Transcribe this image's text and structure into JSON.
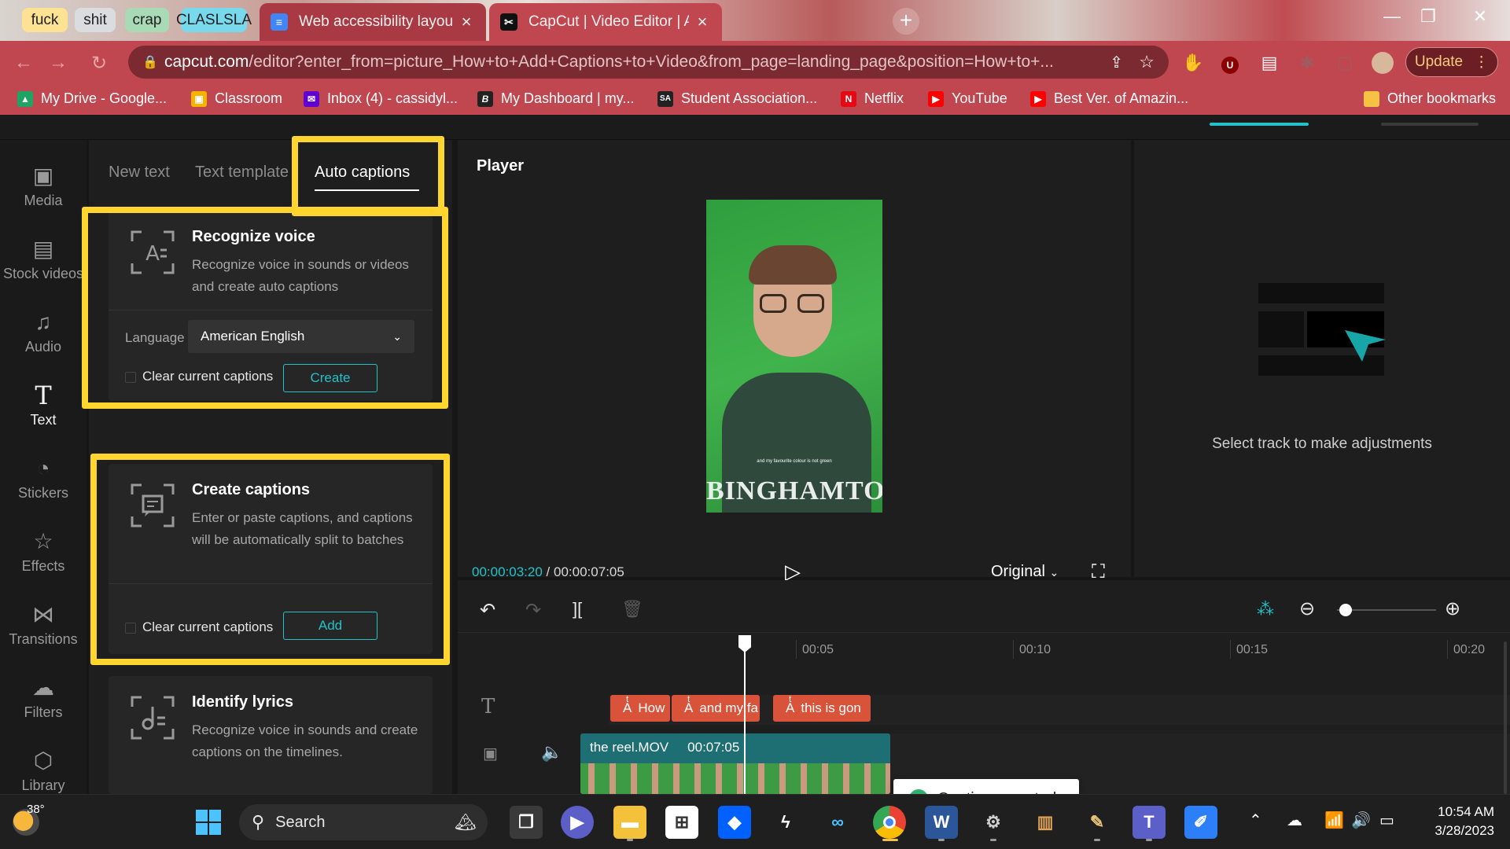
{
  "browser": {
    "tab_groups": [
      {
        "label": "fuck",
        "color": "#fde293"
      },
      {
        "label": "shit",
        "color": "#dadce0"
      },
      {
        "label": "crap",
        "color": "#a8dab5"
      },
      {
        "label": "CLASLSLA",
        "color": "#78d9ec"
      }
    ],
    "tabs": [
      {
        "title": "Web accessibility layout - Google",
        "icon": "docs-icon",
        "color": "#4285f4"
      },
      {
        "title": "CapCut | Video Editor | All-In-One",
        "icon": "capcut-icon",
        "color": "#000000"
      }
    ],
    "url_host": "capcut.com",
    "url_rest": "/editor?enter_from=picture_How+to+Add+Captions+to+Video&from_page=landing_page&position=How+to+...",
    "update_label": "Update",
    "bookmarks": [
      {
        "label": "My Drive - Google...",
        "icon": "drive-icon",
        "color": "#1fa463"
      },
      {
        "label": "Classroom",
        "icon": "classroom-icon",
        "color": "#f4b400"
      },
      {
        "label": "Inbox (4) - cassidyl...",
        "icon": "yahoo-mail-icon",
        "color": "#6001d2"
      },
      {
        "label": "My Dashboard | my...",
        "icon": "dashboard-icon",
        "color": "#222222"
      },
      {
        "label": "Student Association...",
        "icon": "sa-icon",
        "color": "#222222"
      },
      {
        "label": "Netflix",
        "icon": "netflix-icon",
        "color": "#e50914"
      },
      {
        "label": "YouTube",
        "icon": "youtube-icon",
        "color": "#ff0000"
      },
      {
        "label": "Best Ver. of Amazin...",
        "icon": "youtube-icon",
        "color": "#ff0000"
      }
    ],
    "other_bookmarks": "Other bookmarks"
  },
  "sidebar": {
    "items": [
      {
        "label": "Media",
        "icon": "media-icon"
      },
      {
        "label": "Stock videos",
        "icon": "stock-videos-icon"
      },
      {
        "label": "Audio",
        "icon": "audio-icon"
      },
      {
        "label": "Text",
        "icon": "text-icon",
        "active": true
      },
      {
        "label": "Stickers",
        "icon": "stickers-icon"
      },
      {
        "label": "Effects",
        "icon": "effects-icon"
      },
      {
        "label": "Transitions",
        "icon": "transitions-icon"
      },
      {
        "label": "Filters",
        "icon": "filters-icon"
      },
      {
        "label": "Library",
        "icon": "library-icon"
      }
    ]
  },
  "panel": {
    "tabs": [
      "New text",
      "Text template",
      "Auto captions"
    ],
    "recognize": {
      "title": "Recognize voice",
      "desc": "Recognize voice in sounds or videos and create auto captions",
      "language_label": "Language",
      "language_value": "American English",
      "clear_label": "Clear current captions",
      "button": "Create"
    },
    "create": {
      "title": "Create captions",
      "desc": "Enter or paste captions, and captions will be automatically split to batches",
      "clear_label": "Clear current captions",
      "button": "Add"
    },
    "lyrics": {
      "title": "Identify lyrics",
      "desc": "Recognize voice in sounds and create captions on the timelines."
    },
    "highlight_color": "#ffd52e"
  },
  "player": {
    "title": "Player",
    "current_time": "00:00:03:20",
    "separator": "/",
    "total_time": "00:00:07:05",
    "ratio": "Original",
    "caption_text": "and my favourite colour is not green",
    "hoodie_text": "BINGHAMTON"
  },
  "props": {
    "message": "Select track to make adjustments"
  },
  "timeline": {
    "ruler": [
      "00:05",
      "00:10",
      "00:15",
      "00:20"
    ],
    "captions": [
      "How",
      "and my fa",
      "this is gon"
    ],
    "clip_name": "the reel.MOV",
    "clip_duration": "00:07:05",
    "toast": "Captions created",
    "zoom_level": 0.05
  },
  "taskbar": {
    "weather_temp": "38°",
    "search_label": "Search",
    "time": "10:54 AM",
    "date": "3/28/2023"
  },
  "colors": {
    "accent": "#23c2c9",
    "browser_theme": "#c0474f"
  }
}
